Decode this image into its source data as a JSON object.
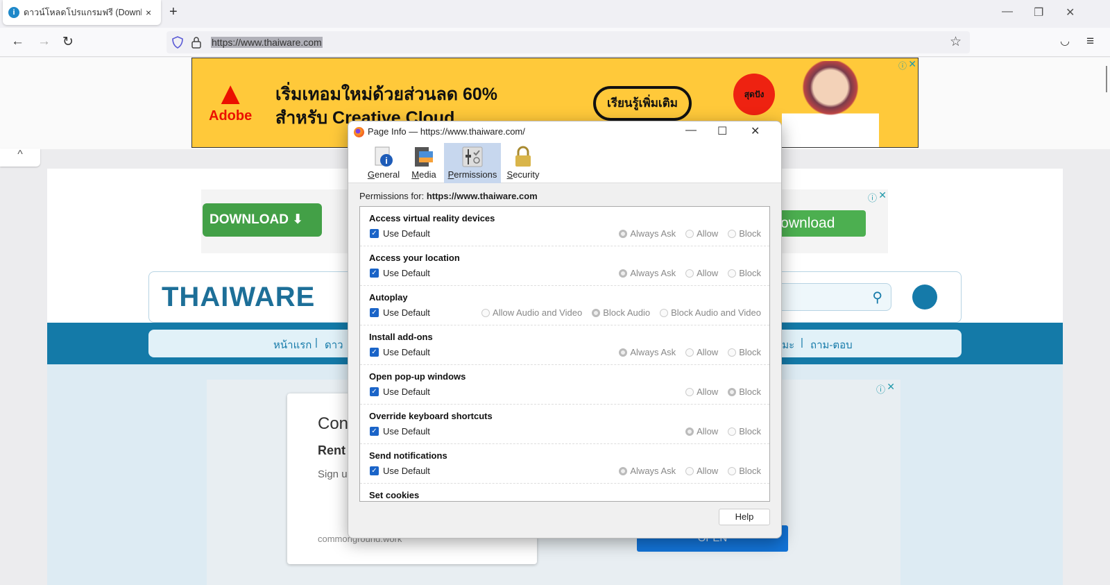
{
  "browser": {
    "tab_title": "ดาวน์โหลดโปรแกรมฟรี (Download",
    "tab_close": "×",
    "new_tab": "+",
    "url": "https://www.thaiware.com",
    "window_controls": {
      "minimize": "—",
      "restore": "❐",
      "close": "✕"
    },
    "nav": {
      "back": "←",
      "forward": "→",
      "reload": "↻",
      "bookmark": "☆",
      "pocket": "◡",
      "menu": "≡"
    }
  },
  "page": {
    "top_ad": {
      "brand": "Adobe",
      "headline_1": "เริ่มเทอมใหม่ด้วยส่วนลด 60%",
      "headline_2": "สำหรับ Creative Cloud",
      "cta": "เรียนรู้เพิ่มเติม",
      "badge": "สุดปัง",
      "accent": "#ffc93a"
    },
    "collapse_icon": "^",
    "download_ad": {
      "button_left": "DOWNLOAD ⬇",
      "button_right": "Download"
    },
    "site": {
      "logo": "THAIWARE",
      "nav_links": [
        "หน้าแรก",
        "ดาว",
        "ธรรมะ",
        "ถาม-ตอบ"
      ],
      "separator": "|",
      "brand_color": "#147aa8"
    },
    "bottom_ad": {
      "title": "Con",
      "subtitle": "Rent",
      "body": "Sign u",
      "domain": "commonground.work",
      "open_button": "OPEN"
    },
    "ad_info_icon": "ⓘ",
    "ad_close_icon": "✕"
  },
  "dialog": {
    "title": "Page Info — https://www.thaiware.com/",
    "controls": {
      "minimize": "—",
      "maximize": "☐",
      "close": "✕"
    },
    "tabs": [
      {
        "label": "General",
        "access": "G",
        "rest": "eneral",
        "icon": "general-icon",
        "selected": false
      },
      {
        "label": "Media",
        "access": "M",
        "rest": "edia",
        "icon": "media-icon",
        "selected": false
      },
      {
        "label": "Permissions",
        "access": "P",
        "rest": "ermissions",
        "icon": "permissions-icon",
        "selected": true
      },
      {
        "label": "Security",
        "access": "S",
        "rest": "ecurity",
        "icon": "security-icon",
        "selected": false
      }
    ],
    "permissions_for_label": "Permissions for:",
    "permissions_for_site": "https://www.thaiware.com",
    "use_default_label": "Use Default",
    "permissions": [
      {
        "name": "Access virtual reality devices",
        "use_default": true,
        "options": [
          "Always Ask",
          "Allow",
          "Block"
        ],
        "selected": "Always Ask"
      },
      {
        "name": "Access your location",
        "use_default": true,
        "options": [
          "Always Ask",
          "Allow",
          "Block"
        ],
        "selected": "Always Ask"
      },
      {
        "name": "Autoplay",
        "use_default": true,
        "options": [
          "Allow Audio and Video",
          "Block Audio",
          "Block Audio and Video"
        ],
        "selected": "Block Audio"
      },
      {
        "name": "Install add-ons",
        "use_default": true,
        "options": [
          "Always Ask",
          "Allow",
          "Block"
        ],
        "selected": "Always Ask"
      },
      {
        "name": "Open pop-up windows",
        "use_default": true,
        "options": [
          "Allow",
          "Block"
        ],
        "selected": "Block"
      },
      {
        "name": "Override keyboard shortcuts",
        "use_default": true,
        "options": [
          "Allow",
          "Block"
        ],
        "selected": "Allow"
      },
      {
        "name": "Send notifications",
        "use_default": true,
        "options": [
          "Always Ask",
          "Allow",
          "Block"
        ],
        "selected": "Always Ask"
      },
      {
        "name": "Set cookies",
        "use_default": true,
        "options": [],
        "selected": ""
      }
    ],
    "help_label": "Help"
  }
}
